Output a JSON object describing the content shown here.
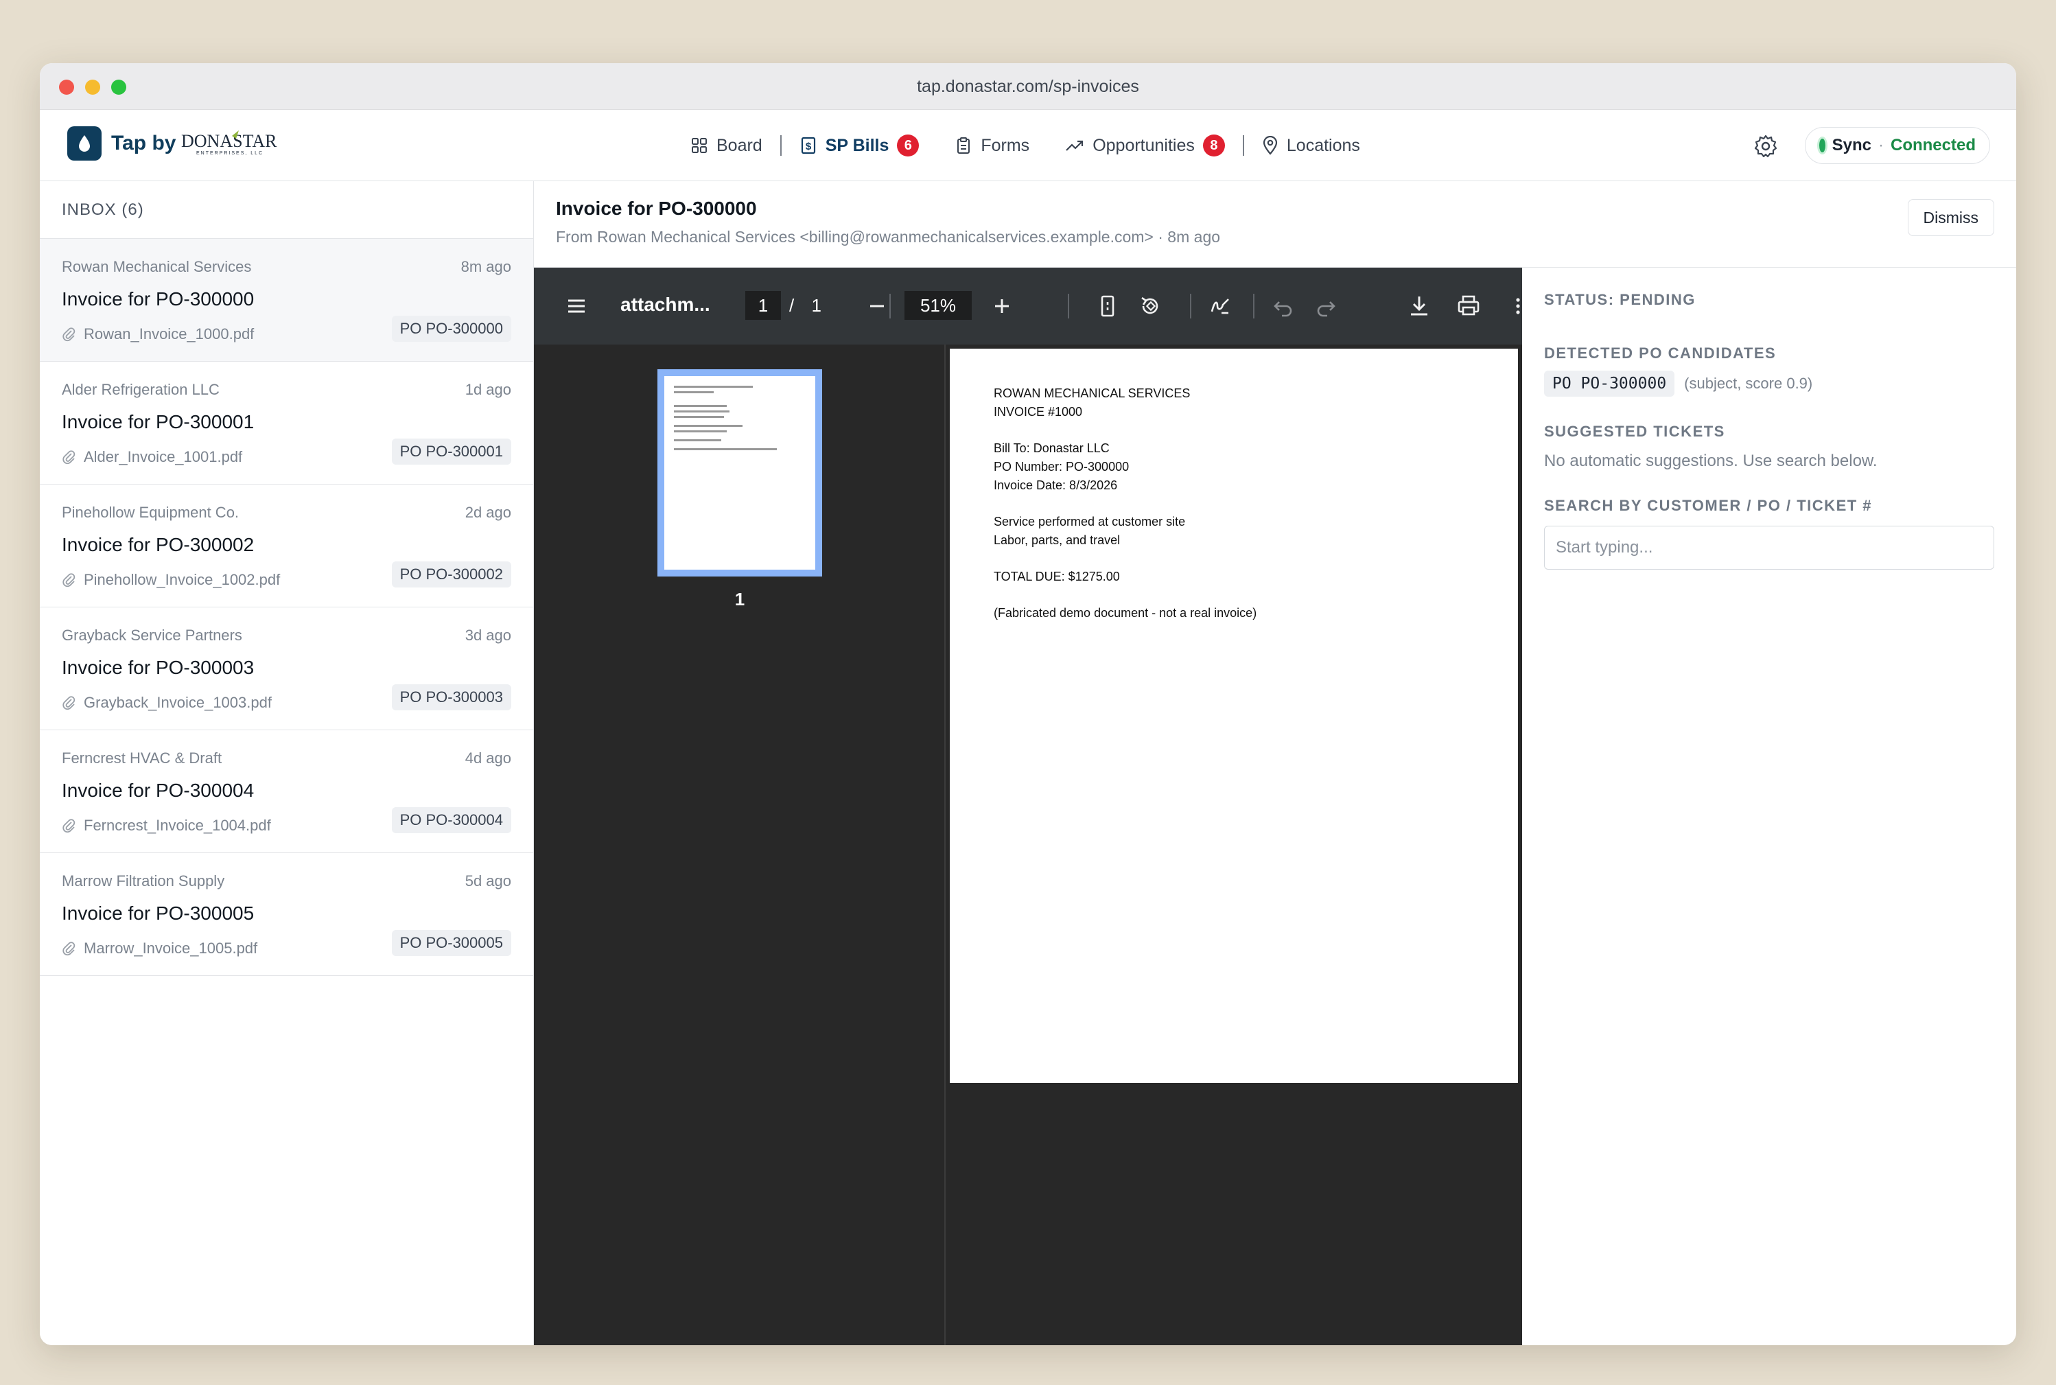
{
  "browser": {
    "url": "tap.donastar.com/sp-invoices"
  },
  "brand": {
    "name": "Tap by",
    "company_logo_text": "DONASTAR",
    "company_logo_sub": "ENTERPRISES, LLC"
  },
  "nav": {
    "items": [
      {
        "label": "Board",
        "icon": "board-icon"
      },
      {
        "label": "SP Bills",
        "icon": "dollar-doc-icon",
        "badge": "6"
      },
      {
        "label": "Forms",
        "icon": "clipboard-icon"
      },
      {
        "label": "Opportunities",
        "icon": "trend-up-icon",
        "badge": "8"
      },
      {
        "label": "Locations",
        "icon": "map-pin-icon"
      }
    ]
  },
  "sync": {
    "label": "Sync",
    "separator": "·",
    "state": "Connected",
    "status_color": "#22a65a"
  },
  "inbox": {
    "title": "INBOX (6)",
    "items": [
      {
        "sender": "Rowan Mechanical Services",
        "time": "8m ago",
        "subject": "Invoice for PO-300000",
        "file": "Rowan_Invoice_1000.pdf",
        "po": "PO PO-300000"
      },
      {
        "sender": "Alder Refrigeration LLC",
        "time": "1d ago",
        "subject": "Invoice for PO-300001",
        "file": "Alder_Invoice_1001.pdf",
        "po": "PO PO-300001"
      },
      {
        "sender": "Pinehollow Equipment Co.",
        "time": "2d ago",
        "subject": "Invoice for PO-300002",
        "file": "Pinehollow_Invoice_1002.pdf",
        "po": "PO PO-300002"
      },
      {
        "sender": "Grayback Service Partners",
        "time": "3d ago",
        "subject": "Invoice for PO-300003",
        "file": "Grayback_Invoice_1003.pdf",
        "po": "PO PO-300003"
      },
      {
        "sender": "Ferncrest HVAC & Draft",
        "time": "4d ago",
        "subject": "Invoice for PO-300004",
        "file": "Ferncrest_Invoice_1004.pdf",
        "po": "PO PO-300004"
      },
      {
        "sender": "Marrow Filtration Supply",
        "time": "5d ago",
        "subject": "Invoice for PO-300005",
        "file": "Marrow_Invoice_1005.pdf",
        "po": "PO PO-300005"
      }
    ]
  },
  "detail": {
    "title": "Invoice for PO-300000",
    "from": "From Rowan Mechanical Services <billing@rowanmechanicalservices.example.com> · 8m ago",
    "dismiss_label": "Dismiss"
  },
  "pdf_viewer": {
    "file_name": "attachm...",
    "current_page": "1",
    "page_separator": "/",
    "total_pages": "1",
    "zoom": "51%",
    "thumbnail_label": "1",
    "document": {
      "header_line1": "ROWAN MECHANICAL SERVICES",
      "header_line2": "INVOICE #1000",
      "bill_to": "Bill To: Donastar LLC",
      "po_number": "PO Number: PO-300000",
      "invoice_date": "Invoice Date: 8/3/2026",
      "service_line1": "Service performed at customer site",
      "service_line2": "Labor, parts, and travel",
      "total_due": "TOTAL DUE: $1275.00",
      "footer_note": "(Fabricated demo document - not a real invoice)"
    }
  },
  "side_panel": {
    "status_label": "STATUS: PENDING",
    "po_candidates_label": "DETECTED PO CANDIDATES",
    "po_candidate": "PO PO-300000",
    "po_candidate_note": "(subject, score 0.9)",
    "suggested_tickets_label": "SUGGESTED TICKETS",
    "suggested_tickets_text": "No automatic suggestions. Use search below.",
    "search_label": "SEARCH BY CUSTOMER / PO / TICKET #",
    "search_placeholder": "Start typing..."
  }
}
